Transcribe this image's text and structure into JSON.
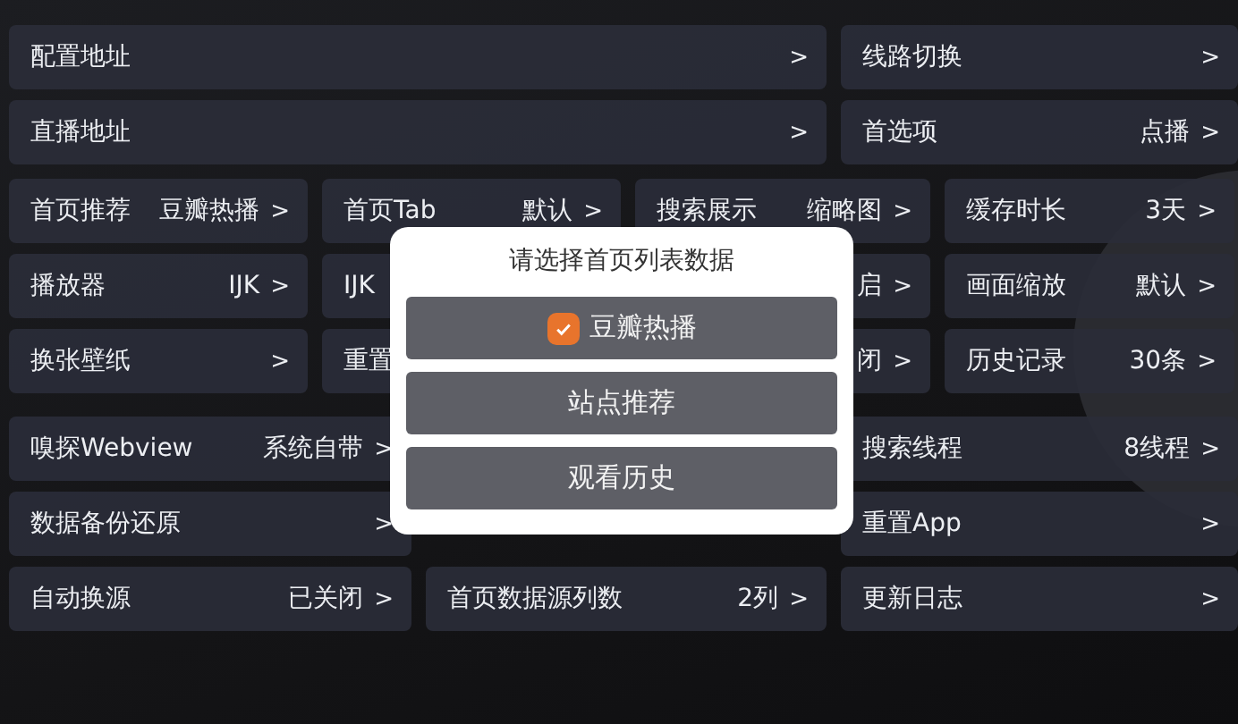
{
  "groups": [
    {
      "rows": [
        {
          "kind": "wide",
          "tiles": [
            {
              "label": "配置地址",
              "arrow": ">"
            },
            {
              "label": "线路切换",
              "arrow": ">"
            }
          ]
        },
        {
          "kind": "wide",
          "tiles": [
            {
              "label": "直播地址",
              "arrow": ">"
            },
            {
              "label": "首选项",
              "value": "点播",
              "arrow": ">"
            }
          ]
        }
      ]
    },
    {
      "rows": [
        {
          "kind": "quad",
          "tiles": [
            {
              "label": "首页推荐",
              "value": "豆瓣热播",
              "arrow": ">"
            },
            {
              "label": "首页Tab",
              "value": "默认",
              "arrow": ">"
            },
            {
              "label": "搜索展示",
              "value": "缩略图",
              "arrow": ">"
            },
            {
              "label": "缓存时长",
              "value": "3天",
              "arrow": ">"
            }
          ]
        },
        {
          "kind": "quad",
          "tiles": [
            {
              "label": "播放器",
              "value": "IJK",
              "arrow": ">"
            },
            {
              "label": "IJK"
            },
            {
              "value": "启",
              "arrow": ">"
            },
            {
              "label": "画面缩放",
              "value": "默认",
              "arrow": ">"
            }
          ]
        },
        {
          "kind": "quad",
          "tiles": [
            {
              "label": "换张壁纸",
              "arrow": ">"
            },
            {
              "label": "重置"
            },
            {
              "value": "闭",
              "arrow": ">"
            },
            {
              "label": "历史记录",
              "value": "30条",
              "arrow": ">"
            }
          ]
        }
      ]
    },
    {
      "rows": [
        {
          "kind": "split",
          "tiles": [
            {
              "label": "嗅探Webview",
              "value": "系统自带",
              "arrow": ">"
            },
            {
              "label": "搜索线程",
              "value": "8线程",
              "arrow": ">"
            }
          ]
        },
        {
          "kind": "split",
          "tiles": [
            {
              "label": "数据备份还原",
              "arrow": ">"
            },
            {
              "label": "重置App",
              "arrow": ">"
            }
          ]
        },
        {
          "kind": "triple",
          "tiles": [
            {
              "label": "自动换源",
              "value": "已关闭",
              "arrow": ">"
            },
            {
              "label": "首页数据源列数",
              "value": "2列",
              "arrow": ">"
            },
            {
              "label": "更新日志",
              "arrow": ">"
            }
          ]
        }
      ]
    }
  ],
  "dialog": {
    "title": "请选择首页列表数据",
    "options": [
      {
        "label": "豆瓣热播",
        "selected": true
      },
      {
        "label": "站点推荐",
        "selected": false
      },
      {
        "label": "观看历史",
        "selected": false
      }
    ]
  }
}
